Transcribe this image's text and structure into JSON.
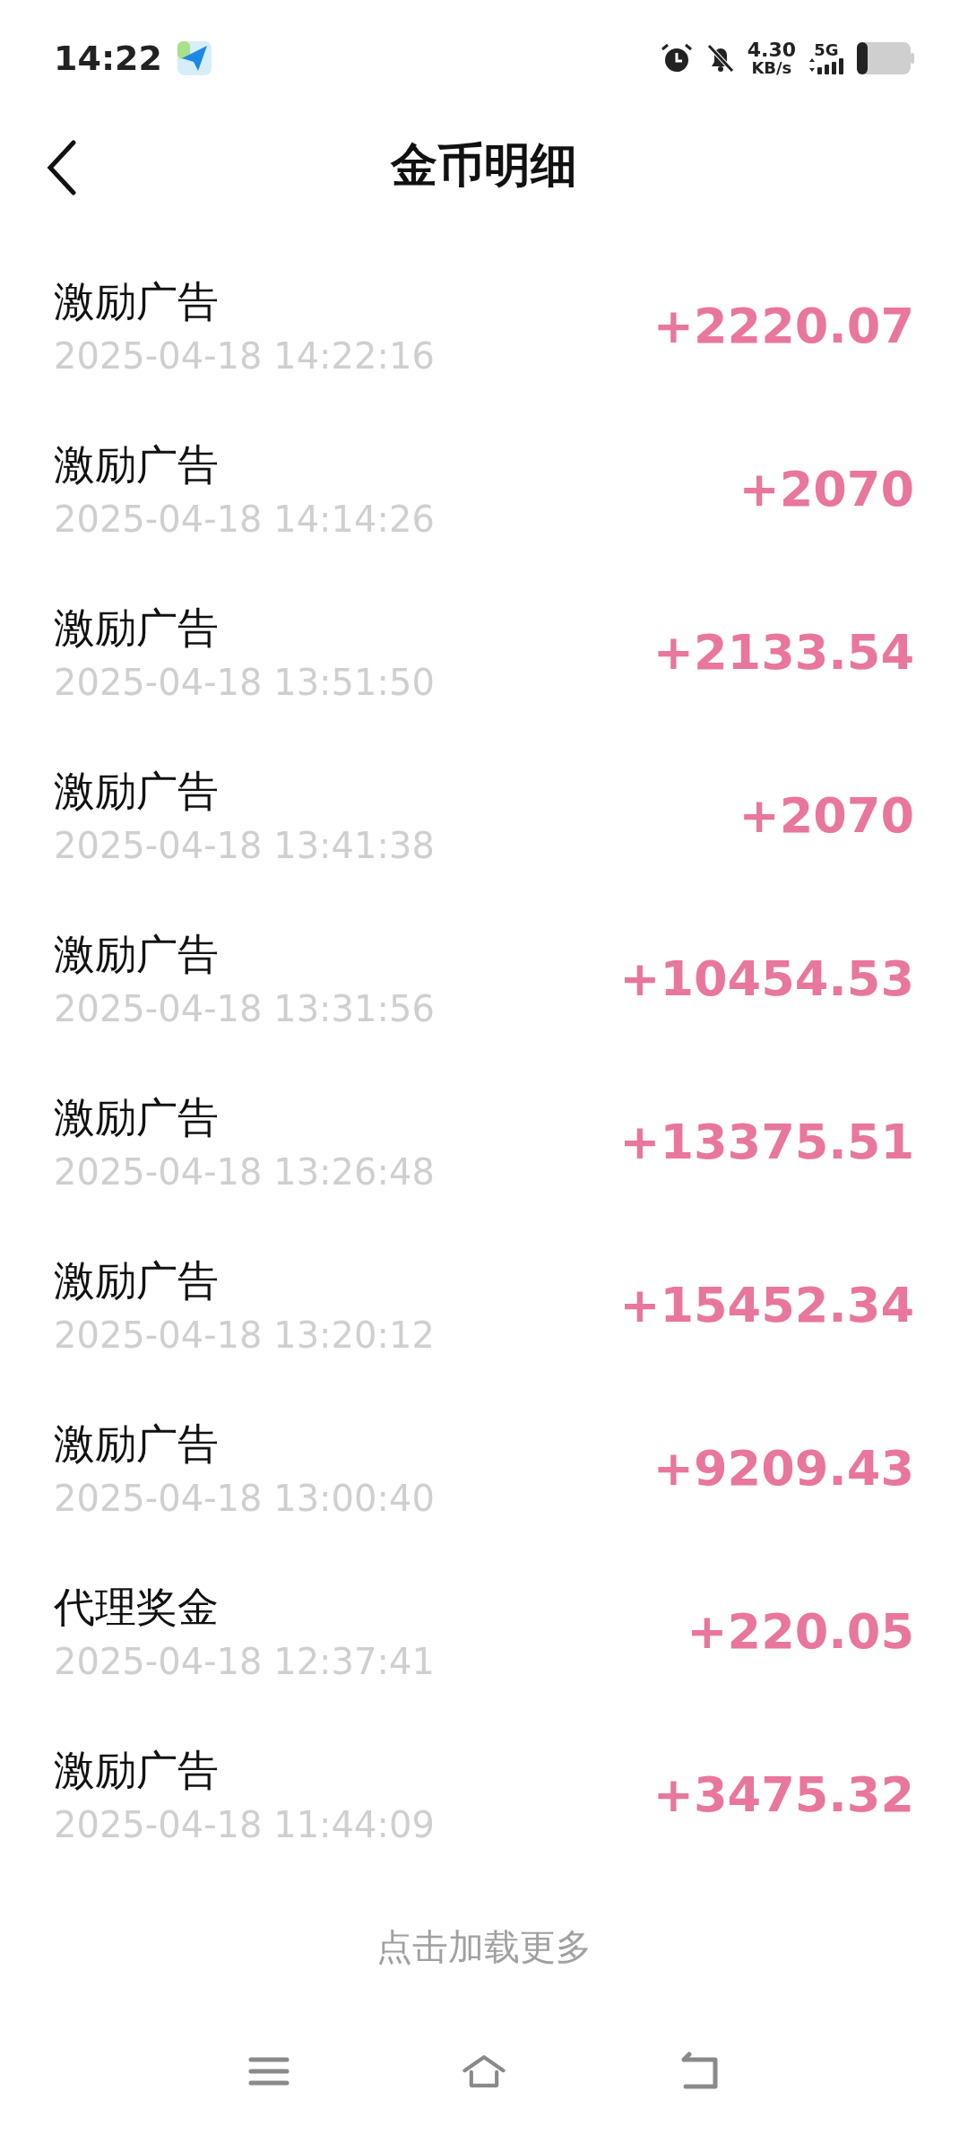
{
  "status_bar": {
    "time": "14:22",
    "net_speed": "4.30",
    "net_unit": "KB/s",
    "network": "5G"
  },
  "header": {
    "title": "金币明细"
  },
  "records": [
    {
      "name": "激励广告",
      "time": "2025-04-18 14:22:16",
      "amount": "+2220.07"
    },
    {
      "name": "激励广告",
      "time": "2025-04-18 14:14:26",
      "amount": "+2070"
    },
    {
      "name": "激励广告",
      "time": "2025-04-18 13:51:50",
      "amount": "+2133.54"
    },
    {
      "name": "激励广告",
      "time": "2025-04-18 13:41:38",
      "amount": "+2070"
    },
    {
      "name": "激励广告",
      "time": "2025-04-18 13:31:56",
      "amount": "+10454.53"
    },
    {
      "name": "激励广告",
      "time": "2025-04-18 13:26:48",
      "amount": "+13375.51"
    },
    {
      "name": "激励广告",
      "time": "2025-04-18 13:20:12",
      "amount": "+15452.34"
    },
    {
      "name": "激励广告",
      "time": "2025-04-18 13:00:40",
      "amount": "+9209.43"
    },
    {
      "name": "代理奖金",
      "time": "2025-04-18 12:37:41",
      "amount": "+220.05"
    },
    {
      "name": "激励广告",
      "time": "2025-04-18 11:44:09",
      "amount": "+3475.32"
    }
  ],
  "load_more": "点击加载更多"
}
